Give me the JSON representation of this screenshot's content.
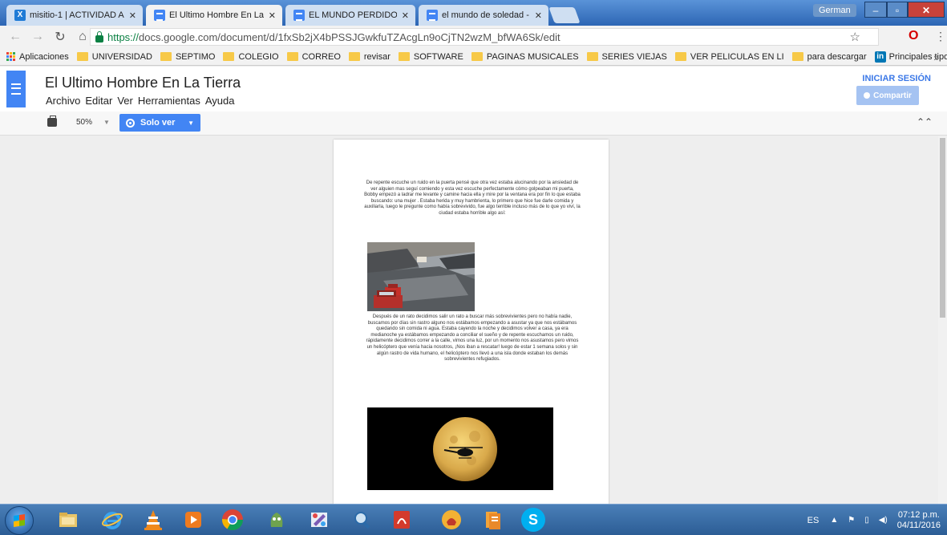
{
  "browser": {
    "tabs": [
      {
        "title": "misitio-1 | ACTIVIDAD A",
        "icon": "site-x-icon"
      },
      {
        "title": "El Ultimo Hombre En La",
        "icon": "docs-icon",
        "active": true
      },
      {
        "title": "EL MUNDO PERDIDO - D",
        "icon": "docs-icon"
      },
      {
        "title": "el mundo de soledad - D",
        "icon": "docs-icon"
      }
    ],
    "user": "German",
    "url_https": "https://",
    "url_rest": "docs.google.com/document/d/1fxSb2jX4bPSSJGwkfuTZAcgLn9oCjTN2wzM_bfWA6Sk/edit",
    "bookmarks": {
      "apps": "Aplicaciones",
      "items": [
        "UNIVERSIDAD",
        "SEPTIMO",
        "COLEGIO",
        "CORREO",
        "revisar",
        "SOFTWARE",
        "PAGINAS MUSICALES",
        "SERIES VIEJAS",
        "VER PELICULAS EN LI",
        "para descargar"
      ],
      "linkedin": "Principales tipos de c",
      "more": "»"
    }
  },
  "docs": {
    "title": "El Ultimo Hombre En La Tierra",
    "menu": [
      "Archivo",
      "Editar",
      "Ver",
      "Herramientas",
      "Ayuda"
    ],
    "signin": "INICIAR SESIÓN",
    "share": "Compartir",
    "zoom": "50%",
    "view_mode": "Solo ver"
  },
  "document": {
    "paragraph1": "De repente escuche un ruido en la puerta pensé que otra vez estaba alucinando por la ansiedad de ver alguien mas seguí comiendo y esta vez escuche perfectamente cómo golpeaban mi puerta, Bobby empezó a ladrar me levante y camine hacia ella y mire por la ventana era por fin lo que estaba buscando: una mujer . Estaba herida y muy hambrienta, lo primero que hice fue darle comida y auxiliarla, luego le pregunte como había sobrevivido, fue algo terrible incluso más de lo que yo viví, la ciudad estaba horrible algo así:",
    "paragraph2": "Después de un rato decidimos salir un rato a buscar más sobrevivientes pero no había nadie, buscamos por días sin rastro alguno nos estábamos empezando a asustar ya que nos estábamos quedando sin comida ni agua. Estaba cayendo la noche y decidimos volver a casa, ya era medianoche ya estábamos empezando a conciliar el sueño y de repente escuchamos un ruido, rápidamente decidimos correr a la calle, vimos una luz, por un momento nos asustamos pero vimos un helicóptero que venía hacia nosotros, ¡Nos iban a rescatar! luego de estar 1 semana solos y sin algún rastro de vida humano, el helicóptero nos llevó a una isla donde estaban los demás sobrevivientes refugiados."
  },
  "taskbar": {
    "lang": "ES",
    "time": "07:12 p.m.",
    "date": "04/11/2016",
    "apps": [
      "explorer-icon",
      "ie-icon",
      "vlc-icon",
      "media-player-icon",
      "chrome-icon",
      "game-icon",
      "paint-icon",
      "search-app-icon",
      "pdf-icon",
      "gesture-icon",
      "files-icon",
      "skype-icon"
    ]
  },
  "colors": {
    "docs_blue": "#4285f4",
    "share_disabled": "#a5c3f2",
    "taskbar": "#2c5d95"
  }
}
